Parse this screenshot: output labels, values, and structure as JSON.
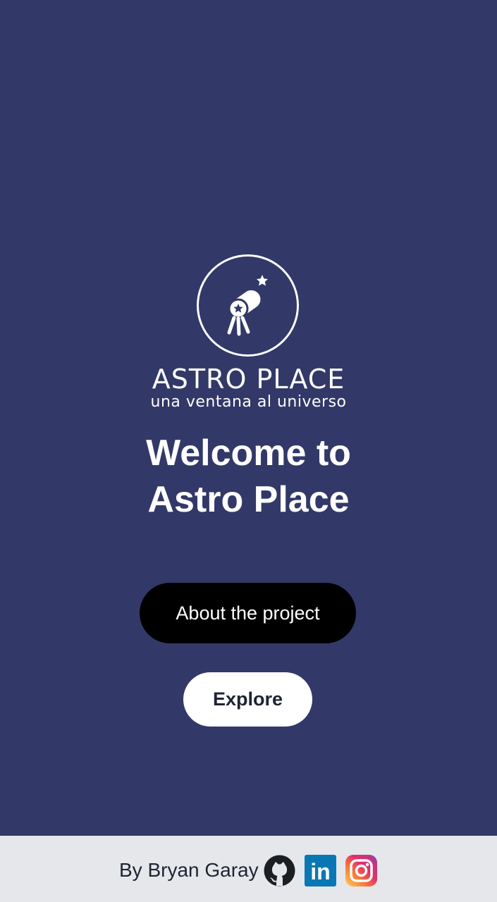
{
  "logo": {
    "wordmark": "ASTRO PLACE",
    "tagline": "una ventana al universo",
    "icon": "telescope-icon"
  },
  "hero": {
    "title_line1": "Welcome to",
    "title_line2": "Astro Place"
  },
  "actions": {
    "about_label": "About the project",
    "explore_label": "Explore"
  },
  "footer": {
    "author": "By Bryan Garay",
    "social": [
      {
        "icon": "github-icon"
      },
      {
        "icon": "linkedin-icon",
        "text": "in"
      },
      {
        "icon": "instagram-icon"
      }
    ]
  },
  "colors": {
    "background": "#323968",
    "footer_background": "#e5e7eb",
    "about_button": "#000000",
    "explore_button": "#ffffff",
    "linkedin": "#0a77b5"
  }
}
